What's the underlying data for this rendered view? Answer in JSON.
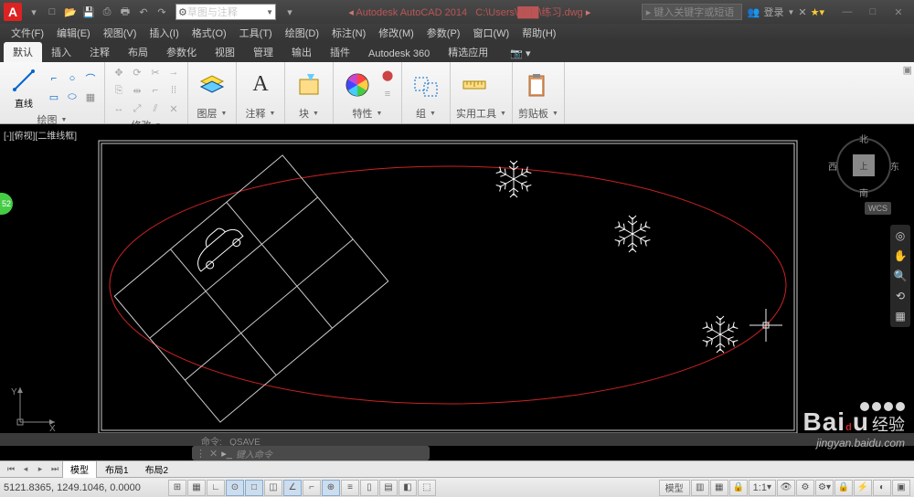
{
  "title": {
    "app": "Autodesk AutoCAD 2014",
    "file": "C:\\Users\\███\\练习.dwg",
    "workspace": "草图与注释",
    "search_placeholder": "键入关键字或短语",
    "login": "登录"
  },
  "menubar": [
    "文件(F)",
    "编辑(E)",
    "视图(V)",
    "插入(I)",
    "格式(O)",
    "工具(T)",
    "绘图(D)",
    "标注(N)",
    "修改(M)",
    "参数(P)",
    "窗口(W)",
    "帮助(H)"
  ],
  "ribbon_tabs": [
    "默认",
    "插入",
    "注释",
    "布局",
    "参数化",
    "视图",
    "管理",
    "输出",
    "插件",
    "Autodesk 360",
    "精选应用"
  ],
  "ribbon_active": 0,
  "panels": {
    "draw": {
      "label": "绘图",
      "btn": "直线"
    },
    "modify": {
      "label": "修改"
    },
    "layer": {
      "label": "图层"
    },
    "annot": {
      "label": "注释"
    },
    "block": {
      "label": "块"
    },
    "prop": {
      "label": "特性"
    },
    "group": {
      "label": "组"
    },
    "util": {
      "label": "实用工具"
    },
    "clip": {
      "label": "剪贴板"
    }
  },
  "viewport_label": "[-][俯视][二维线框]",
  "viewcube": {
    "n": "北",
    "s": "南",
    "e": "东",
    "w": "西",
    "top": "上"
  },
  "wcs": "WCS",
  "ucs": {
    "x": "X",
    "y": "Y"
  },
  "green_badge": "52",
  "cmd": {
    "history": "命令: _QSAVE",
    "prompt": "键入命令"
  },
  "layout_tabs": [
    "模型",
    "布局1",
    "布局2"
  ],
  "layout_active": 0,
  "status": {
    "coords": "5121.8365, 1249.1046, 0.0000",
    "model_btn": "模型",
    "scale": "1:1"
  },
  "watermark": {
    "brand": "Baidu",
    "exp": "经验",
    "url": "jingyan.baidu.com"
  }
}
